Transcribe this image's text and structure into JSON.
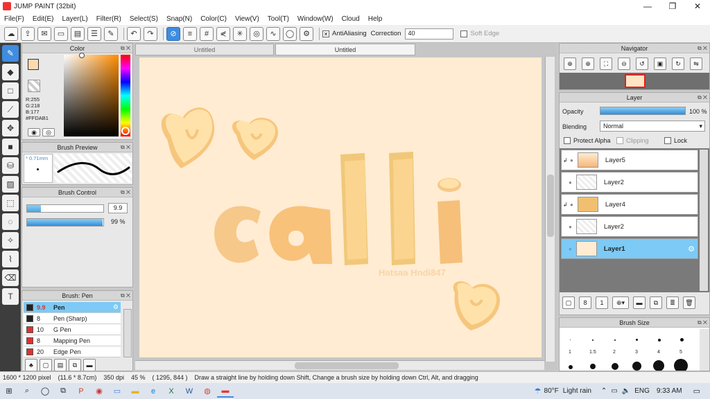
{
  "window": {
    "title": "JUMP PAINT (32bit)",
    "minimize": "—",
    "maximize": "❐",
    "close": "✕"
  },
  "menu": [
    "File(F)",
    "Edit(E)",
    "Layer(L)",
    "Filter(R)",
    "Select(S)",
    "Snap(N)",
    "Color(C)",
    "View(V)",
    "Tool(T)",
    "Window(W)",
    "Cloud",
    "Help"
  ],
  "toolbar": {
    "antialiasing_label": "AntiAliasing",
    "correction_label": "Correction",
    "correction_value": "40",
    "soft_edge_label": "Soft Edge"
  },
  "color_panel": {
    "title": "Color",
    "r": "R:255",
    "g": "G:218",
    "b": "B:177",
    "hex": "#FFDAB1",
    "fg_color": "#FFDAB1"
  },
  "brush_preview": {
    "title": "Brush Preview",
    "size": "* 0.71mm"
  },
  "brush_control": {
    "title": "Brush Control",
    "size_value": "9.9",
    "opacity_value": "99 %",
    "size_fraction": 0.18,
    "opacity_fraction": 0.99
  },
  "brush_list": {
    "title": "Brush: Pen",
    "items": [
      {
        "size": "9.9",
        "name": "Pen",
        "color": "#222222"
      },
      {
        "size": "8",
        "name": "Pen (Sharp)",
        "color": "#222222"
      },
      {
        "size": "10",
        "name": "G Pen",
        "color": "#e03030"
      },
      {
        "size": "8",
        "name": "Mapping Pen",
        "color": "#e03030"
      },
      {
        "size": "20",
        "name": "Edge Pen",
        "color": "#e03030"
      }
    ]
  },
  "tabs": [
    "Untitled",
    "Untitled"
  ],
  "navigator": {
    "title": "Navigator"
  },
  "layer_panel": {
    "title": "Layer",
    "opacity_label": "Opacity",
    "opacity_value": "100 %",
    "opacity_fraction": 1.0,
    "blending_label": "Blending",
    "blending_value": "Normal",
    "protect_alpha": "Protect Alpha",
    "clipping": "Clipping",
    "lock": "Lock",
    "layers": [
      "Layer5",
      "Layer2",
      "Layer4",
      "Layer2",
      "Layer1"
    ]
  },
  "brush_size": {
    "title": "Brush Size",
    "labels": [
      "1",
      "1.5",
      "2",
      "3",
      "4",
      "5"
    ]
  },
  "status": {
    "dimensions": "1600 * 1200 pixel",
    "physical": "(11.6 * 8.7cm)",
    "dpi": "350 dpi",
    "zoom": "45 %",
    "coords": "( 1295, 844 )",
    "hint": "Draw a straight line by holding down Shift, Change a brush size by holding down Ctrl, Alt, and dragging"
  },
  "artwork": {
    "text": "calli",
    "signature": "Hatsaa Hndi847"
  },
  "taskbar": {
    "weather": "80°F",
    "weather_desc": "Light rain",
    "lang": "ENG",
    "time": "9:33 AM"
  },
  "colors": {
    "accent": "#3f8ce0",
    "canvas_bg": "#ffecd2",
    "letters": "#f6c889",
    "selected_row": "#7ccaf5"
  }
}
